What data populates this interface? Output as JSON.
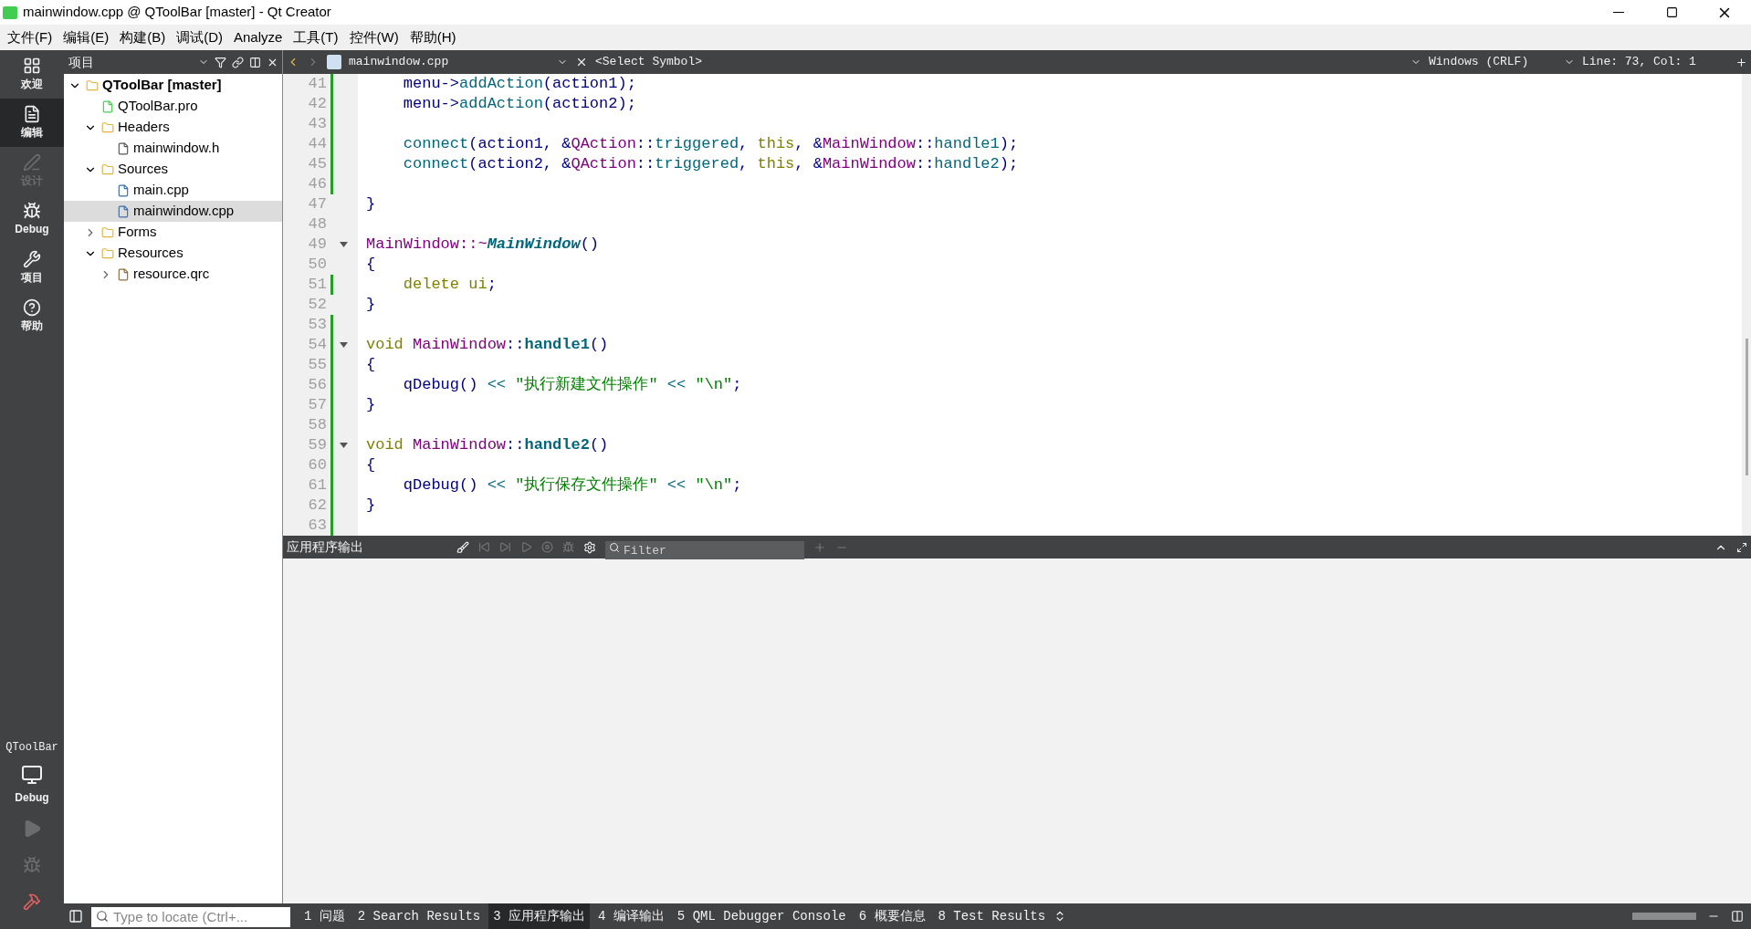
{
  "window": {
    "title": "mainwindow.cpp @ QToolBar [master] - Qt Creator"
  },
  "menu": [
    "文件(F)",
    "编辑(E)",
    "构建(B)",
    "调试(D)",
    "Analyze",
    "工具(T)",
    "控件(W)",
    "帮助(H)"
  ],
  "modes": [
    {
      "label": "欢迎",
      "kind": "welcome",
      "selected": false,
      "disabled": false
    },
    {
      "label": "编辑",
      "kind": "edit",
      "selected": true,
      "disabled": false
    },
    {
      "label": "设计",
      "kind": "design",
      "selected": false,
      "disabled": true
    },
    {
      "label": "Debug",
      "kind": "debug",
      "selected": false,
      "disabled": false
    },
    {
      "label": "项目",
      "kind": "projects",
      "selected": false,
      "disabled": false
    },
    {
      "label": "帮助",
      "kind": "help",
      "selected": false,
      "disabled": false
    }
  ],
  "target": {
    "project": "QToolBar",
    "config": "Debug"
  },
  "project_panel": {
    "title": "项目",
    "tree": [
      {
        "label": "QToolBar [master]",
        "kind": "project",
        "expanded": true,
        "selected": false,
        "children": [
          {
            "label": "QToolBar.pro",
            "kind": "pro",
            "selected": false
          },
          {
            "label": "Headers",
            "kind": "folder",
            "expanded": true,
            "selected": false,
            "children": [
              {
                "label": "mainwindow.h",
                "kind": "header",
                "selected": false
              }
            ]
          },
          {
            "label": "Sources",
            "kind": "folder",
            "expanded": true,
            "selected": false,
            "children": [
              {
                "label": "main.cpp",
                "kind": "source",
                "selected": false
              },
              {
                "label": "mainwindow.cpp",
                "kind": "source",
                "selected": true
              }
            ]
          },
          {
            "label": "Forms",
            "kind": "folder",
            "expanded": false,
            "selected": false
          },
          {
            "label": "Resources",
            "kind": "folder",
            "expanded": true,
            "selected": false,
            "children": [
              {
                "label": "resource.qrc",
                "kind": "qrc",
                "expanded": false,
                "selected": false
              }
            ]
          }
        ]
      }
    ]
  },
  "editor": {
    "file": "mainwindow.cpp",
    "symbol": "<Select Symbol>",
    "line_ending": "Windows (CRLF)",
    "position": "Line: 73, Col: 1",
    "lines": [
      {
        "number": "41",
        "modified": true,
        "tokens": [
          {
            "kind": "plain",
            "text": "    menu->"
          },
          {
            "kind": "func",
            "text": "addAction"
          },
          {
            "kind": "plain",
            "text": "(action1);"
          }
        ]
      },
      {
        "number": "42",
        "modified": true,
        "tokens": [
          {
            "kind": "plain",
            "text": "    menu->"
          },
          {
            "kind": "func",
            "text": "addAction"
          },
          {
            "kind": "plain",
            "text": "(action2);"
          }
        ]
      },
      {
        "number": "43",
        "modified": true
      },
      {
        "number": "44",
        "modified": true,
        "tokens": [
          {
            "kind": "func",
            "text": "    connect"
          },
          {
            "kind": "plain",
            "text": "(action1, &"
          },
          {
            "kind": "type",
            "text": "QAction"
          },
          {
            "kind": "plain",
            "text": "::"
          },
          {
            "kind": "func",
            "text": "triggered"
          },
          {
            "kind": "plain",
            "text": ", "
          },
          {
            "kind": "keyword",
            "text": "this"
          },
          {
            "kind": "plain",
            "text": ", &"
          },
          {
            "kind": "type",
            "text": "MainWindow"
          },
          {
            "kind": "plain",
            "text": "::"
          },
          {
            "kind": "func",
            "text": "handle1"
          },
          {
            "kind": "plain",
            "text": ");"
          }
        ]
      },
      {
        "number": "45",
        "modified": true,
        "tokens": [
          {
            "kind": "func",
            "text": "    connect"
          },
          {
            "kind": "plain",
            "text": "(action2, &"
          },
          {
            "kind": "type",
            "text": "QAction"
          },
          {
            "kind": "plain",
            "text": "::"
          },
          {
            "kind": "func",
            "text": "triggered"
          },
          {
            "kind": "plain",
            "text": ", "
          },
          {
            "kind": "keyword",
            "text": "this"
          },
          {
            "kind": "plain",
            "text": ", &"
          },
          {
            "kind": "type",
            "text": "MainWindow"
          },
          {
            "kind": "plain",
            "text": "::"
          },
          {
            "kind": "func",
            "text": "handle2"
          },
          {
            "kind": "plain",
            "text": ");"
          }
        ]
      },
      {
        "number": "46",
        "modified": true
      },
      {
        "number": "47",
        "tokens": [
          {
            "kind": "plain",
            "text": "}"
          }
        ]
      },
      {
        "number": "48"
      },
      {
        "number": "49",
        "fold": true,
        "tokens": [
          {
            "kind": "type",
            "text": "MainWindow::~"
          },
          {
            "kind": "decl_italic",
            "text": "MainWindow"
          },
          {
            "kind": "plain",
            "text": "()"
          }
        ]
      },
      {
        "number": "50",
        "tokens": [
          {
            "kind": "plain",
            "text": "{"
          }
        ]
      },
      {
        "number": "51",
        "modified": true,
        "tokens": [
          {
            "kind": "keyword",
            "text": "    delete ui"
          },
          {
            "kind": "plain",
            "text": ";"
          }
        ]
      },
      {
        "number": "52",
        "tokens": [
          {
            "kind": "plain",
            "text": "}"
          }
        ]
      },
      {
        "number": "53",
        "modified": true
      },
      {
        "number": "54",
        "modified": true,
        "fold": true,
        "tokens": [
          {
            "kind": "keyword",
            "text": "void "
          },
          {
            "kind": "type",
            "text": "MainWindow"
          },
          {
            "kind": "plain",
            "text": "::"
          },
          {
            "kind": "decl",
            "text": "handle1"
          },
          {
            "kind": "plain",
            "text": "()"
          }
        ]
      },
      {
        "number": "55",
        "modified": true,
        "tokens": [
          {
            "kind": "plain",
            "text": "{"
          }
        ]
      },
      {
        "number": "56",
        "modified": true,
        "tokens": [
          {
            "kind": "plain",
            "text": "    qDebug() "
          },
          {
            "kind": "op",
            "text": "<<"
          },
          {
            "kind": "string",
            "text": " \"执行新建文件操作\" "
          },
          {
            "kind": "op",
            "text": "<<"
          },
          {
            "kind": "string",
            "text": " \"\\n\""
          },
          {
            "kind": "plain",
            "text": ";"
          }
        ]
      },
      {
        "number": "57",
        "modified": true,
        "tokens": [
          {
            "kind": "plain",
            "text": "}"
          }
        ]
      },
      {
        "number": "58",
        "modified": true
      },
      {
        "number": "59",
        "modified": true,
        "fold": true,
        "tokens": [
          {
            "kind": "keyword",
            "text": "void "
          },
          {
            "kind": "type",
            "text": "MainWindow"
          },
          {
            "kind": "plain",
            "text": "::"
          },
          {
            "kind": "decl",
            "text": "handle2"
          },
          {
            "kind": "plain",
            "text": "()"
          }
        ]
      },
      {
        "number": "60",
        "modified": true,
        "tokens": [
          {
            "kind": "plain",
            "text": "{"
          }
        ]
      },
      {
        "number": "61",
        "modified": true,
        "tokens": [
          {
            "kind": "plain",
            "text": "    qDebug() "
          },
          {
            "kind": "op",
            "text": "<<"
          },
          {
            "kind": "string",
            "text": " \"执行保存文件操作\" "
          },
          {
            "kind": "op",
            "text": "<<"
          },
          {
            "kind": "string",
            "text": " \"\\n\""
          },
          {
            "kind": "plain",
            "text": ";"
          }
        ]
      },
      {
        "number": "62",
        "modified": true,
        "tokens": [
          {
            "kind": "plain",
            "text": "}"
          }
        ]
      },
      {
        "number": "63",
        "modified": true
      }
    ]
  },
  "output_pane": {
    "title": "应用程序输出",
    "filter": {
      "placeholder": "Filter"
    }
  },
  "status_bar": {
    "locator": {
      "placeholder": "Type to locate (Ctrl+..."
    },
    "tabs": [
      {
        "label": "1 问题",
        "selected": false
      },
      {
        "label": "2 Search Results",
        "selected": false
      },
      {
        "label": "3 应用程序输出",
        "selected": true
      },
      {
        "label": "4 编译输出",
        "selected": false
      },
      {
        "label": "5 QML Debugger Console",
        "selected": false
      },
      {
        "label": "6 概要信息",
        "selected": false
      },
      {
        "label": "8 Test Results",
        "selected": false
      }
    ]
  }
}
